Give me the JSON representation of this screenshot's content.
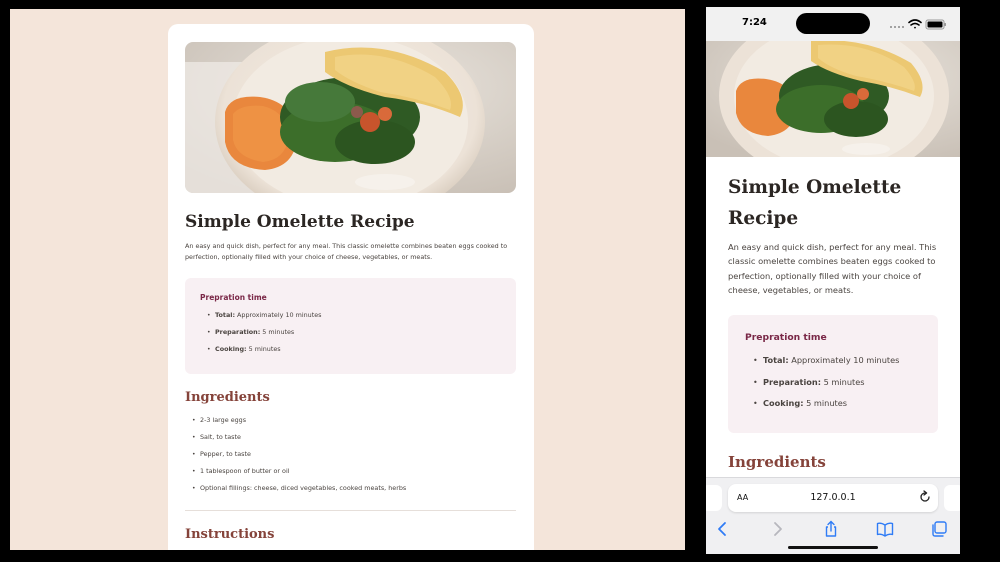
{
  "desktop": {
    "title": "Simple Omelette Recipe",
    "description": "An easy and quick dish, perfect for any meal. This classic omelette combines beaten eggs cooked to perfection, optionally filled with your choice of cheese, vegetables, or meats.",
    "prep": {
      "title": "Prepration time",
      "items": [
        {
          "label": "Total:",
          "value": " Approximately 10 minutes"
        },
        {
          "label": "Preparation:",
          "value": " 5 minutes"
        },
        {
          "label": "Cooking:",
          "value": " 5 minutes"
        }
      ]
    },
    "ingredients_title": "Ingredients",
    "ingredients": [
      "2-3 large eggs",
      "Salt, to taste",
      "Pepper, to taste",
      "1 tablespoon of butter or oil",
      "Optional fillings: cheese, diced vegetables, cooked meats, herbs"
    ],
    "instructions_title": "Instructions"
  },
  "mobile": {
    "time": "7:24",
    "title": "Simple Omelette Recipe",
    "description": "An easy and quick dish, perfect for any meal. This classic omelette combines beaten eggs cooked to perfection, optionally filled with your choice of cheese, vegetables, or meats.",
    "prep": {
      "title": "Prepration time",
      "items": [
        {
          "label": "Total:",
          "value": " Approximately 10 minutes"
        },
        {
          "label": "Preparation:",
          "value": " 5 minutes"
        },
        {
          "label": "Cooking:",
          "value": " 5 minutes"
        }
      ]
    },
    "ingredients_title": "Ingredients",
    "browser": {
      "text_size": "AA",
      "url": "127.0.0.1"
    }
  },
  "colors": {
    "page_bg": "#f4e5da",
    "heading_brown": "#85433a",
    "prep_title": "#7a2847",
    "prep_bg": "#f8f0f3"
  },
  "icons": [
    "wifi-icon",
    "battery-icon",
    "reload-icon",
    "back-icon",
    "forward-icon",
    "share-icon",
    "bookmarks-icon",
    "tabs-icon"
  ]
}
